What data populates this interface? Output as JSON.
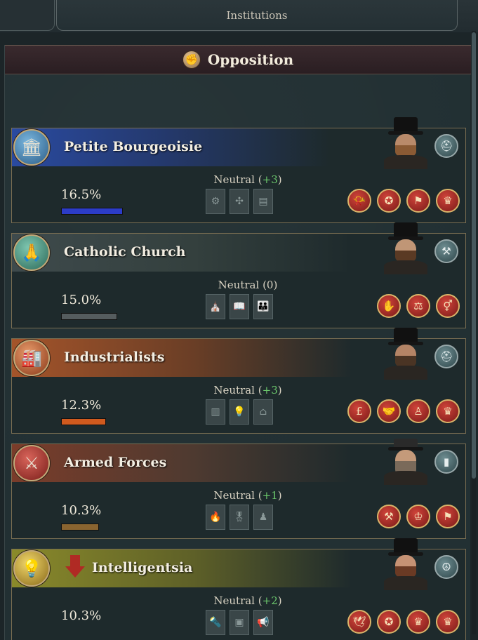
{
  "top_tab": {
    "label": "Institutions"
  },
  "header": {
    "title": "Opposition",
    "icon": "opposition-fist-icon"
  },
  "colors": {
    "positive_modifier": "#6cc86c",
    "band_petite_bourgeoisie": "#2a4aa0",
    "band_catholic_church": "#3e4a4c",
    "band_industrialists": "#a4542a",
    "band_armed_forces": "#7a3c2a",
    "band_intelligentsia": "#8a8a2a"
  },
  "interest_groups": [
    {
      "name": "Petite Bourgeoisie",
      "emblem": "house-icon",
      "leader_badge": "hat-badge-icon",
      "approval_label": "Neutral",
      "approval_mod_open": "(",
      "approval_mod": "+3",
      "approval_mod_close": ")",
      "clout": "16.5%",
      "clout_fraction": 0.165,
      "bar_color": "#2c3cc8",
      "traits": [
        "trait-mechanism-icon",
        "trait-gears-icon",
        "trait-document-icon"
      ],
      "ideologies": [
        "ideology-horn-icon",
        "ideology-medal-icon",
        "ideology-flag-icon",
        "ideology-crown-icon"
      ]
    },
    {
      "name": "Catholic Church",
      "emblem": "praying-hands-icon",
      "leader_badge": "hammer-badge-icon",
      "approval_label": "Neutral",
      "approval_mod_open": "(",
      "approval_mod": "0",
      "approval_mod_close": ")",
      "clout": "15.0%",
      "clout_fraction": 0.15,
      "bar_color": "#555c5e",
      "traits": [
        "trait-cathedral-icon",
        "trait-book-icon",
        "trait-family-icon"
      ],
      "ideologies": [
        "ideology-praying-icon",
        "ideology-scales-icon",
        "ideology-gender-icon"
      ]
    },
    {
      "name": "Industrialists",
      "emblem": "factory-icon",
      "leader_badge": "hat-badge-icon",
      "approval_label": "Neutral",
      "approval_mod_open": "(",
      "approval_mod": "+3",
      "approval_mod_close": ")",
      "clout": "12.3%",
      "clout_fraction": 0.123,
      "bar_color": "#d05a1e",
      "traits": [
        "trait-ledger-icon",
        "trait-bulb-icon",
        "trait-factory-icon"
      ],
      "ideologies": [
        "ideology-pound-icon",
        "ideology-handshake-icon",
        "ideology-worker-icon",
        "ideology-crown-icon"
      ]
    },
    {
      "name": "Armed Forces",
      "emblem": "crossed-swords-icon",
      "leader_badge": "flag-badge-icon",
      "approval_label": "Neutral",
      "approval_mod_open": "(",
      "approval_mod": "+1",
      "approval_mod_close": ")",
      "clout": "10.3%",
      "clout_fraction": 0.103,
      "bar_color": "#8a6430",
      "traits": [
        "trait-fire-icon",
        "trait-medal-icon",
        "trait-salute-icon"
      ],
      "ideologies": [
        "ideology-hammer-icon",
        "ideology-leader-icon",
        "ideology-flag-icon"
      ]
    },
    {
      "name": "Intelligentsia",
      "emblem": "lightbulb-icon",
      "leader_badge": "peace-badge-icon",
      "approval_label": "Neutral",
      "approval_mod_open": "(",
      "approval_mod": "+2",
      "approval_mod_close": ")",
      "clout": "10.3%",
      "clout_fraction": 0.103,
      "bar_color": "#8a8a2a",
      "traits": [
        "trait-torch-icon",
        "trait-portrait-icon",
        "trait-megaphone-icon"
      ],
      "ideologies": [
        "ideology-dove-icon",
        "ideology-medal-icon",
        "ideology-crown-icon",
        "ideology-crown-icon"
      ]
    }
  ]
}
